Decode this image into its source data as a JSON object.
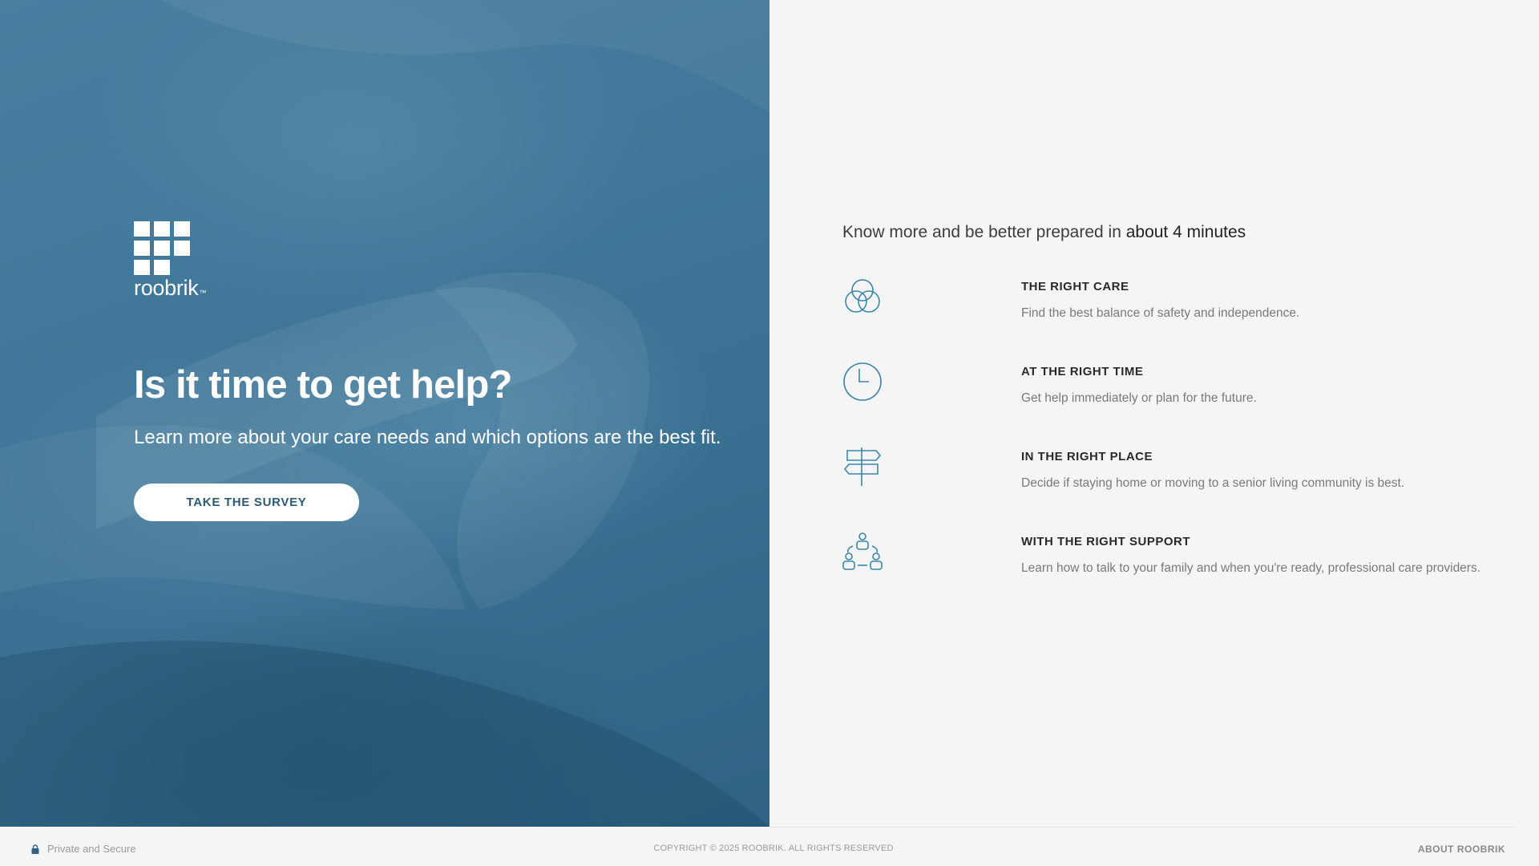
{
  "brand": {
    "name": "roobrik",
    "trademark": "™",
    "hero_color": "#3f7697",
    "accent_color": "#3a86a8"
  },
  "hero": {
    "title": "Is it time to get help?",
    "subtitle": "Learn more about your care needs and which options are the best fit.",
    "cta_label": "TAKE THE SURVEY"
  },
  "panel": {
    "intro_prefix": "Know more and be better prepared in ",
    "intro_emphasis": "about 4 minutes",
    "features": [
      {
        "icon": "venn-circles-icon",
        "title": "THE RIGHT CARE",
        "description": "Find the best balance of safety and independence."
      },
      {
        "icon": "clock-icon",
        "title": "AT THE RIGHT TIME",
        "description": "Get help immediately or plan for the future."
      },
      {
        "icon": "signpost-icon",
        "title": "IN THE RIGHT PLACE",
        "description": "Decide if staying home or moving to a senior living community is best."
      },
      {
        "icon": "people-network-icon",
        "title": "WITH THE RIGHT SUPPORT",
        "description": "Learn how to talk to your family and when you're ready, professional care providers."
      }
    ]
  },
  "footer": {
    "secure_icon": "lock-icon",
    "secure_label": "Private and Secure",
    "copyright": "COPYRIGHT © 2025 ROOBRIK. ALL RIGHTS RESERVED",
    "about_label": "ABOUT ROOBRIK"
  }
}
